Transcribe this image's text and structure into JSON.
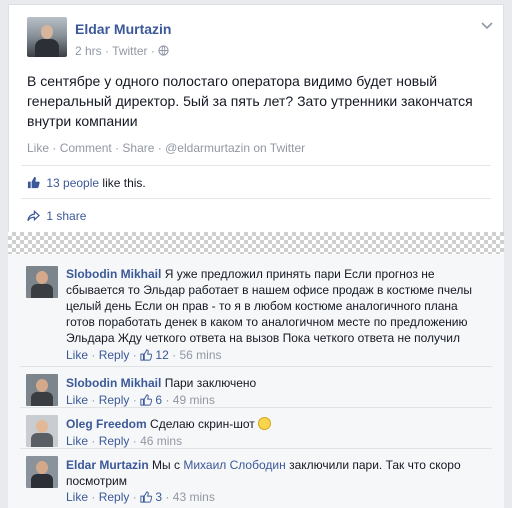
{
  "post": {
    "author": "Eldar Murtazin",
    "time": "2 hrs",
    "sep": "·",
    "via": "Twitter",
    "privacy_icon": "globe-icon",
    "text": "В сентябре у одного полостагo оператора видимо будет новый генеральный директор. 5ый за пять лет? Зато утренники закончатся внутри компании",
    "actions": {
      "like": "Like",
      "comment": "Comment",
      "share": "Share",
      "twitter": "@eldarmurtazin on Twitter",
      "sep": "·"
    },
    "likes": {
      "people": "13 people",
      "suffix": "like this."
    },
    "shares": "1 share"
  },
  "comments": [
    {
      "name": "Slobodin Mikhail",
      "text": "Я уже предложил принять пари Если прогноз не сбывается то Эльдар работает в нашем офисе продаж в костюме пчелы целый день Если он прав - то я в любом костюме аналогичного плана готов поработать денек в каком то аналогичном месте по предложению Эльдара Жду четкого ответа на вызов Пока четкого ответа не получил",
      "like": "Like",
      "reply": "Reply",
      "likes": "12",
      "time": "56 mins"
    },
    {
      "name": "Slobodin Mikhail",
      "text": "Пари заключено",
      "like": "Like",
      "reply": "Reply",
      "likes": "6",
      "time": "49 mins"
    },
    {
      "name": "Oleg Freedom",
      "text": "Сделаю скрин-шот",
      "like": "Like",
      "reply": "Reply",
      "time": "46 mins"
    },
    {
      "name": "Eldar Murtazin",
      "text_pre": "Мы с",
      "mention": "Михаил Слободин",
      "text_post": "заключили пари. Так что скоро посмотрим",
      "like": "Like",
      "reply": "Reply",
      "likes": "3",
      "time": "43 mins"
    }
  ],
  "colors": {
    "link": "#3b5998",
    "muted": "#9197a3",
    "text": "#141823",
    "comments_bg": "#f6f7f9"
  }
}
